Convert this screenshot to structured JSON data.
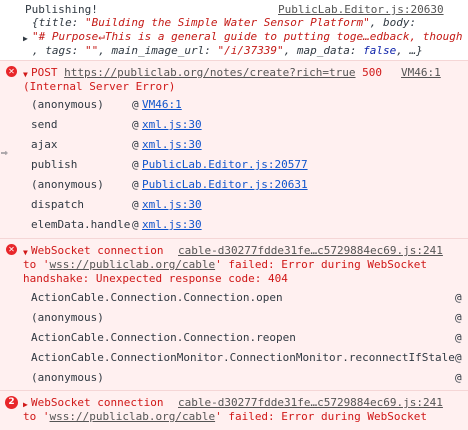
{
  "log": {
    "text": "Publishing!",
    "source": "PublicLab.Editor.js:20630",
    "obj_line1_prefix": "{title: ",
    "obj_title": "\"Building the Simple Water Sensor Platform\"",
    "obj_line1_suffix": ", body:",
    "obj_line2_body": "\"# Purpose↵This is a general guide to putting toge…edback, though",
    "obj_line3_a": ", tags: ",
    "obj_tags": "\"\"",
    "obj_line3_b": ", main_image_url: ",
    "obj_img": "\"/i/37339\"",
    "obj_line3_c": ", map_data: ",
    "obj_false": "false",
    "obj_line3_d": ", …}"
  },
  "post_error": {
    "prefix": "POST ",
    "url": "https://publiclab.org/notes/create?rich=true",
    "status": "500",
    "source": "VM46:1",
    "line2": "(Internal Server Error)",
    "stack": [
      {
        "fn": "(anonymous)",
        "at": "@",
        "src": "VM46:1"
      },
      {
        "fn": "send",
        "at": "@",
        "src": "xml.js:30"
      },
      {
        "fn": "ajax",
        "at": "@",
        "src": "xml.js:30"
      },
      {
        "fn": "publish",
        "at": "@",
        "src": "PublicLab.Editor.js:20577"
      },
      {
        "fn": "(anonymous)",
        "at": "@",
        "src": "PublicLab.Editor.js:20631"
      },
      {
        "fn": "dispatch",
        "at": "@",
        "src": "xml.js:30"
      },
      {
        "fn": "elemData.handle",
        "at": "@",
        "src": "xml.js:30"
      }
    ]
  },
  "ws_error1": {
    "prefix": "WebSocket connection",
    "source": "cable-d30277fdde31fe…c5729884ec69.js:241",
    "line2_a": "to '",
    "line2_url": "wss://publiclab.org/cable",
    "line2_b": "' failed: Error during WebSocket",
    "line3": "handshake: Unexpected response code: 404",
    "stack": [
      {
        "fn": "ActionCable.Connection.Connection.open",
        "at": "@ ."
      },
      {
        "fn": "(anonymous)",
        "at": "@ ."
      },
      {
        "fn": "ActionCable.Connection.Connection.reopen",
        "at": "@ ."
      },
      {
        "fn": "ActionCable.ConnectionMonitor.ConnectionMonitor.reconnectIfStale",
        "at": "@ ."
      },
      {
        "fn": "(anonymous)",
        "at": "@ ."
      }
    ]
  },
  "ws_error2": {
    "count": "2",
    "prefix": "WebSocket connection",
    "source": "cable-d30277fdde31fe…c5729884ec69.js:241",
    "line2_a": "to '",
    "line2_url": "wss://publiclab.org/cable",
    "line2_b": "' failed: Error during WebSocket"
  }
}
